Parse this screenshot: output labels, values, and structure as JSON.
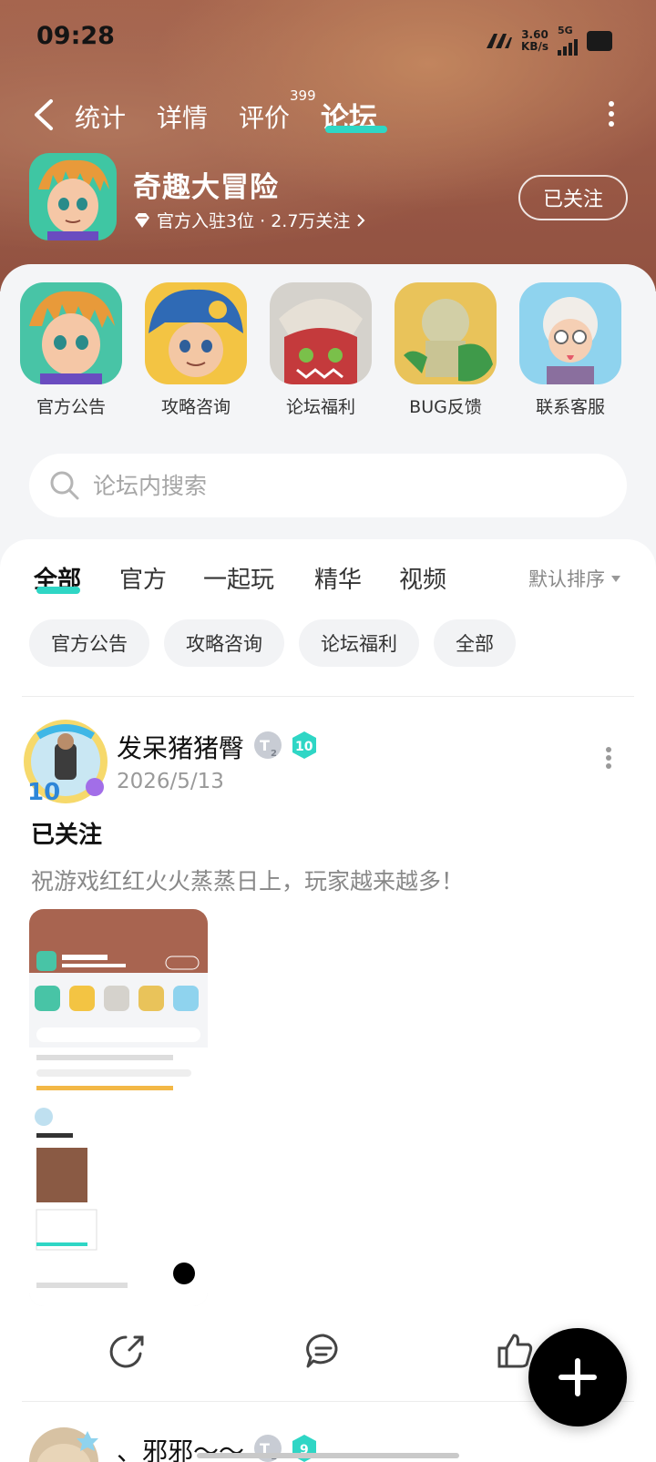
{
  "status_bar": {
    "time": "09:28",
    "net_speed": "3.60",
    "net_unit": "KB/s",
    "network": "5G"
  },
  "nav": {
    "tabs": [
      "统计",
      "详情",
      "评价",
      "论坛"
    ],
    "active_tab": "论坛",
    "review_count": "399"
  },
  "game": {
    "name": "奇趣大冒险",
    "meta": "官方入驻3位 · 2.7万关注",
    "follow_label": "已关注"
  },
  "channels": [
    {
      "label": "官方公告"
    },
    {
      "label": "攻略咨询"
    },
    {
      "label": "论坛福利"
    },
    {
      "label": "BUG反馈"
    },
    {
      "label": "联系客服"
    }
  ],
  "search": {
    "placeholder": "论坛内搜索"
  },
  "filter_tabs": [
    "全部",
    "官方",
    "一起玩",
    "精华",
    "视频"
  ],
  "active_filter": "全部",
  "sort_label": "默认排序",
  "chips": [
    "官方公告",
    "攻略咨询",
    "论坛福利",
    "全部"
  ],
  "post": {
    "user": "发呆猪猪臀",
    "badge_level": "10",
    "badge_t_level": "2",
    "date": "2026/5/13",
    "title": "已关注",
    "body": "祝游戏红红火火蒸蒸日上，玩家越来越多！"
  },
  "next_post": {
    "user": "、邪邪～～",
    "badge_level": "9",
    "badge_t_level": "1"
  },
  "colors": {
    "accent": "#2fd6c5",
    "hero_bg": "#a86450"
  }
}
